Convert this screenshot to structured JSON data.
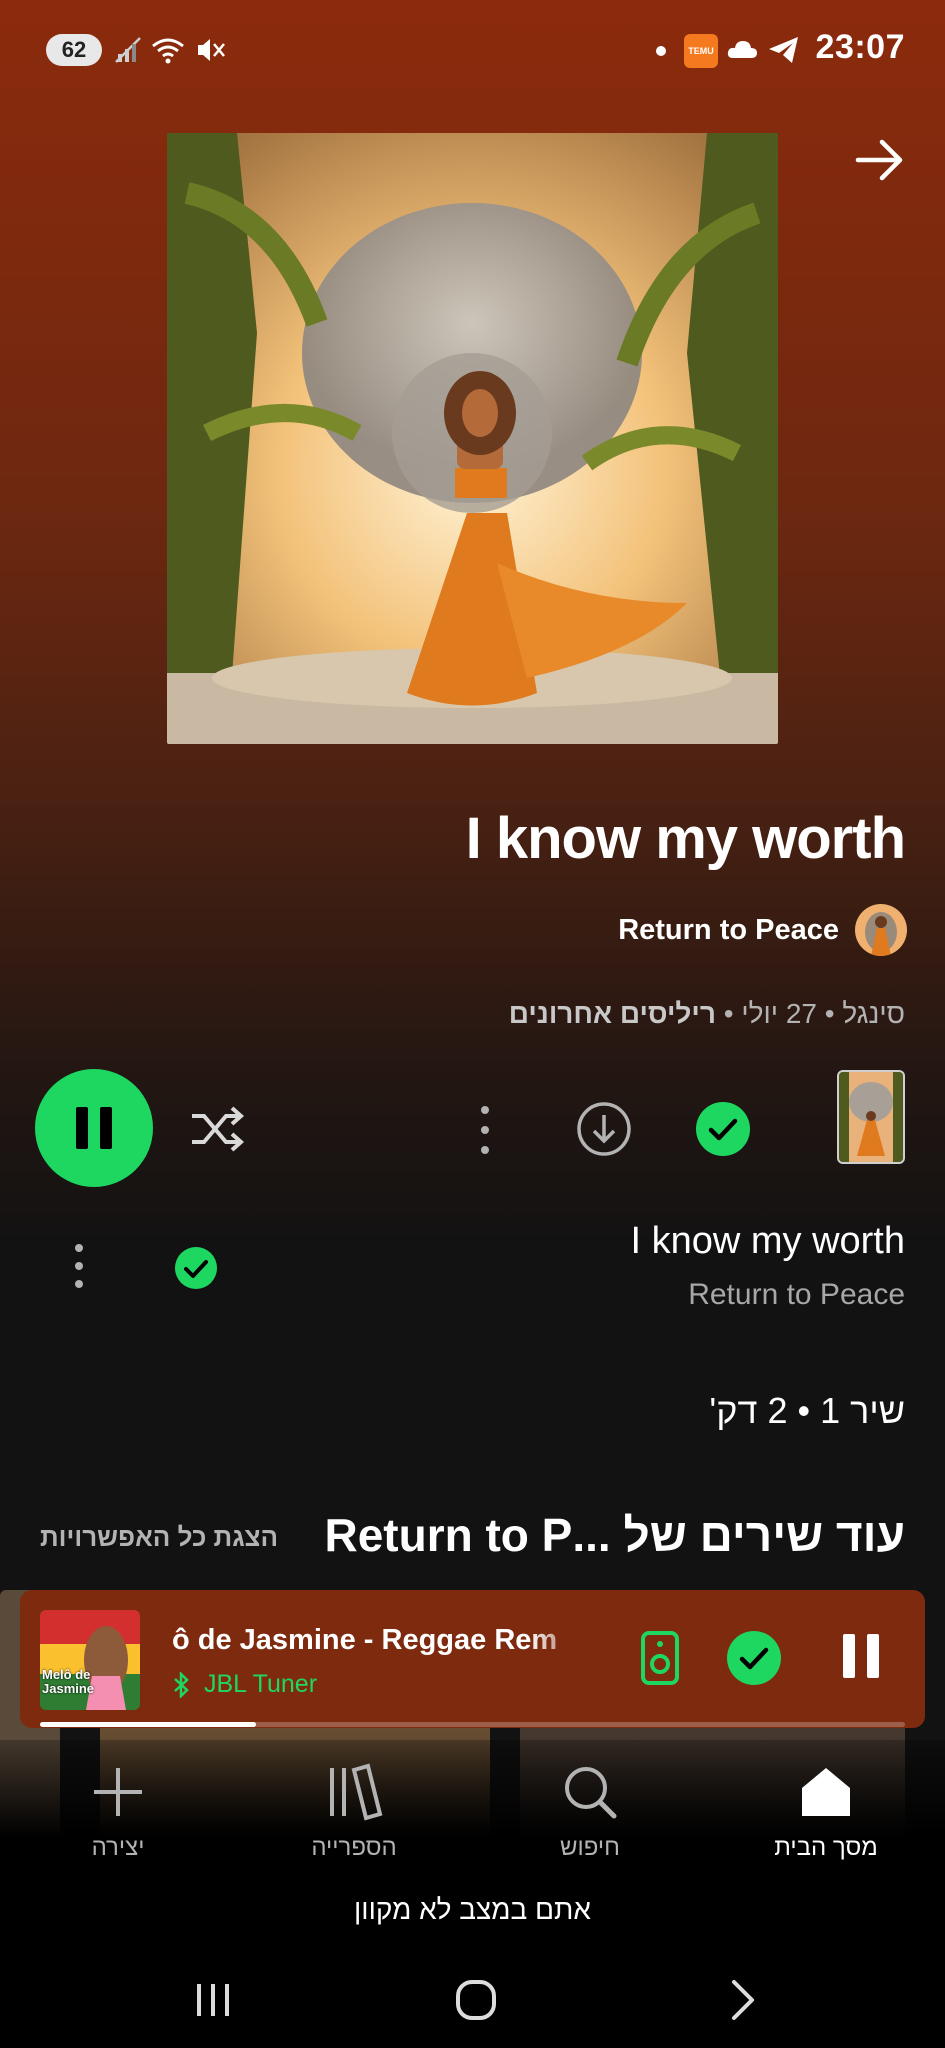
{
  "status_bar": {
    "battery": "62",
    "time": "23:07",
    "notification_badge": "TEMU"
  },
  "song": {
    "title": "I know my worth",
    "artist": "Return to Peace",
    "meta_type": "סינגל",
    "meta_date": "27 יולי",
    "meta_section": "ריליסים אחרונים"
  },
  "track_list": [
    {
      "title": "I know my worth",
      "artist": "Return to Peace"
    }
  ],
  "summary": "שיר 1 • 2 דק'",
  "more_songs": {
    "heading": "עוד שירים של ...Return to P",
    "show_all": "הצגת כל האפשרויות"
  },
  "mini_player": {
    "title": "ô de Jasmine - Reggae Rem",
    "device": "JBL Tuner",
    "art_text_top": "Melô de",
    "art_text_bottom": "Jasmine",
    "progress": 0.25
  },
  "bottom_nav": [
    {
      "label": "יצירה",
      "icon": "plus-icon"
    },
    {
      "label": "הספרייה",
      "icon": "library-icon"
    },
    {
      "label": "חיפוש",
      "icon": "search-icon"
    },
    {
      "label": "מסך הבית",
      "icon": "home-icon"
    }
  ],
  "offline_message": "אתם במצב לא מקוון",
  "colors": {
    "accent_green": "#1ed760",
    "header_bg": "#8c2a0c",
    "mini_player_bg": "#7e2a0e",
    "secondary_text": "#b3b3b3"
  }
}
